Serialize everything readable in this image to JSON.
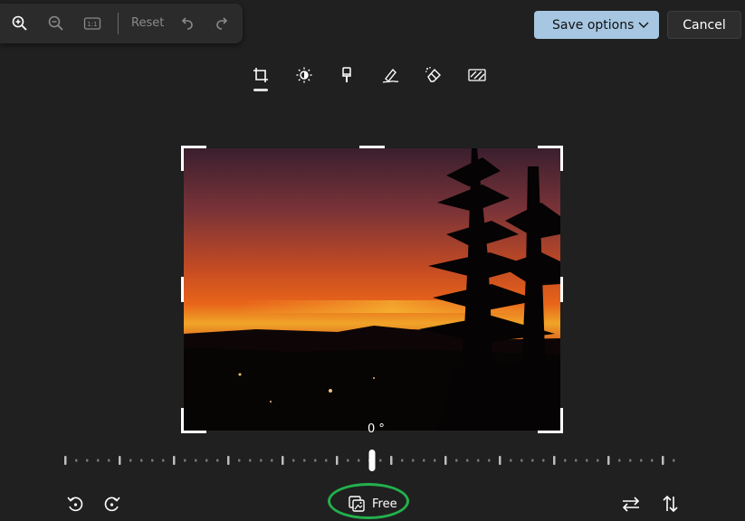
{
  "zoom_bar": {
    "zoom_in": "zoom-in-icon",
    "zoom_out": "zoom-out-icon",
    "actual_size_label": "1:1",
    "reset_label": "Reset",
    "undo": "undo-icon",
    "redo": "redo-icon"
  },
  "header": {
    "save_label": "Save options",
    "cancel_label": "Cancel"
  },
  "tools": [
    {
      "name": "crop",
      "icon": "crop-icon",
      "active": true
    },
    {
      "name": "adjustment",
      "icon": "brightness-icon"
    },
    {
      "name": "filter",
      "icon": "filter-icon"
    },
    {
      "name": "markup",
      "icon": "markup-icon"
    },
    {
      "name": "erase",
      "icon": "eraser-icon"
    },
    {
      "name": "background",
      "icon": "background-icon"
    }
  ],
  "crop": {
    "angle_label": "0 °",
    "angle_value": 0,
    "aspect_label": "Free"
  },
  "bottom": {
    "rotate_left": "rotate-left-icon",
    "rotate_right": "rotate-right-icon",
    "aspect_icon": "aspect-ratio-icon",
    "flip_horizontal": "flip-horizontal-icon",
    "flip_vertical": "flip-vertical-icon"
  },
  "colors": {
    "background": "#202020",
    "accent": "#a6c6e1",
    "highlight_oval": "#22b14c"
  }
}
